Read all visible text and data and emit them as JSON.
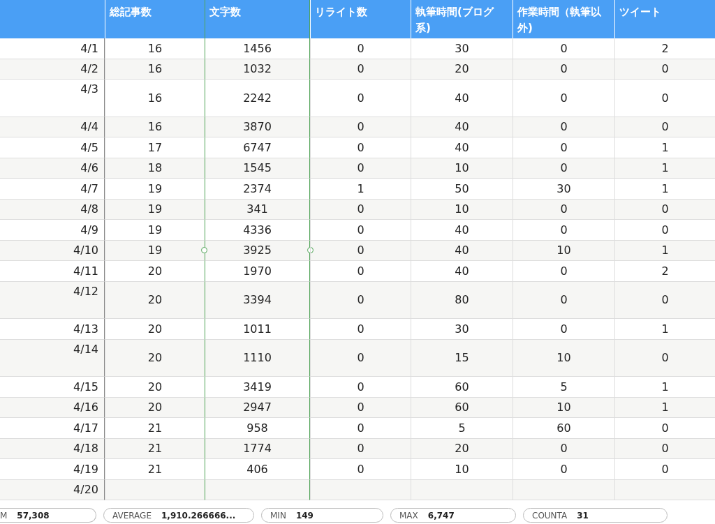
{
  "columns": [
    {
      "selected": false
    },
    {
      "label": "総記事数",
      "selected": false
    },
    {
      "label": "文字数",
      "selected": true
    },
    {
      "label": "リライト数",
      "selected": false
    },
    {
      "label": "執筆時間(ブログ系)",
      "selected": false
    },
    {
      "label": "作業時間（執筆以外)",
      "selected": false
    },
    {
      "label": "ツイート",
      "selected": false
    }
  ],
  "rows": [
    {
      "cells": [
        "4/1",
        "16",
        "1456",
        "0",
        "30",
        "0",
        "2"
      ],
      "tall": false,
      "handles": false
    },
    {
      "cells": [
        "4/2",
        "16",
        "1032",
        "0",
        "20",
        "0",
        "0"
      ],
      "tall": false,
      "handles": false
    },
    {
      "cells": [
        "4/3",
        "16",
        "2242",
        "0",
        "40",
        "0",
        "0"
      ],
      "tall": true,
      "handles": false
    },
    {
      "cells": [
        "4/4",
        "16",
        "3870",
        "0",
        "40",
        "0",
        "0"
      ],
      "tall": false,
      "handles": false
    },
    {
      "cells": [
        "4/5",
        "17",
        "6747",
        "0",
        "40",
        "0",
        "1"
      ],
      "tall": false,
      "handles": false
    },
    {
      "cells": [
        "4/6",
        "18",
        "1545",
        "0",
        "10",
        "0",
        "1"
      ],
      "tall": false,
      "handles": false
    },
    {
      "cells": [
        "4/7",
        "19",
        "2374",
        "1",
        "50",
        "30",
        "1"
      ],
      "tall": false,
      "handles": false
    },
    {
      "cells": [
        "4/8",
        "19",
        "341",
        "0",
        "10",
        "0",
        "0"
      ],
      "tall": false,
      "handles": false
    },
    {
      "cells": [
        "4/9",
        "19",
        "4336",
        "0",
        "40",
        "0",
        "0"
      ],
      "tall": false,
      "handles": false
    },
    {
      "cells": [
        "4/10",
        "19",
        "3925",
        "0",
        "40",
        "10",
        "1"
      ],
      "tall": false,
      "handles": true
    },
    {
      "cells": [
        "4/11",
        "20",
        "1970",
        "0",
        "40",
        "0",
        "2"
      ],
      "tall": false,
      "handles": false
    },
    {
      "cells": [
        "4/12",
        "20",
        "3394",
        "0",
        "80",
        "0",
        "0"
      ],
      "tall": true,
      "handles": false
    },
    {
      "cells": [
        "4/13",
        "20",
        "1011",
        "0",
        "30",
        "0",
        "1"
      ],
      "tall": false,
      "handles": false
    },
    {
      "cells": [
        "4/14",
        "20",
        "1110",
        "0",
        "15",
        "10",
        "0"
      ],
      "tall": true,
      "handles": false
    },
    {
      "cells": [
        "4/15",
        "20",
        "3419",
        "0",
        "60",
        "5",
        "1"
      ],
      "tall": false,
      "handles": false
    },
    {
      "cells": [
        "4/16",
        "20",
        "2947",
        "0",
        "60",
        "10",
        "1"
      ],
      "tall": false,
      "handles": false
    },
    {
      "cells": [
        "4/17",
        "21",
        "958",
        "0",
        "5",
        "60",
        "0"
      ],
      "tall": false,
      "handles": false
    },
    {
      "cells": [
        "4/18",
        "21",
        "1774",
        "0",
        "20",
        "0",
        "0"
      ],
      "tall": false,
      "handles": false
    },
    {
      "cells": [
        "4/19",
        "21",
        "406",
        "0",
        "10",
        "0",
        "0"
      ],
      "tall": false,
      "handles": false
    },
    {
      "cells": [
        "4/20",
        "",
        "",
        "",
        "",
        "",
        ""
      ],
      "tall": false,
      "handles": false
    }
  ],
  "status_bar": [
    {
      "label": "M",
      "value": "57,308"
    },
    {
      "label": "AVERAGE",
      "value": "1,910.266666..."
    },
    {
      "label": "MIN",
      "value": "149"
    },
    {
      "label": "MAX",
      "value": "6,747"
    },
    {
      "label": "COUNTA",
      "value": "31"
    }
  ]
}
